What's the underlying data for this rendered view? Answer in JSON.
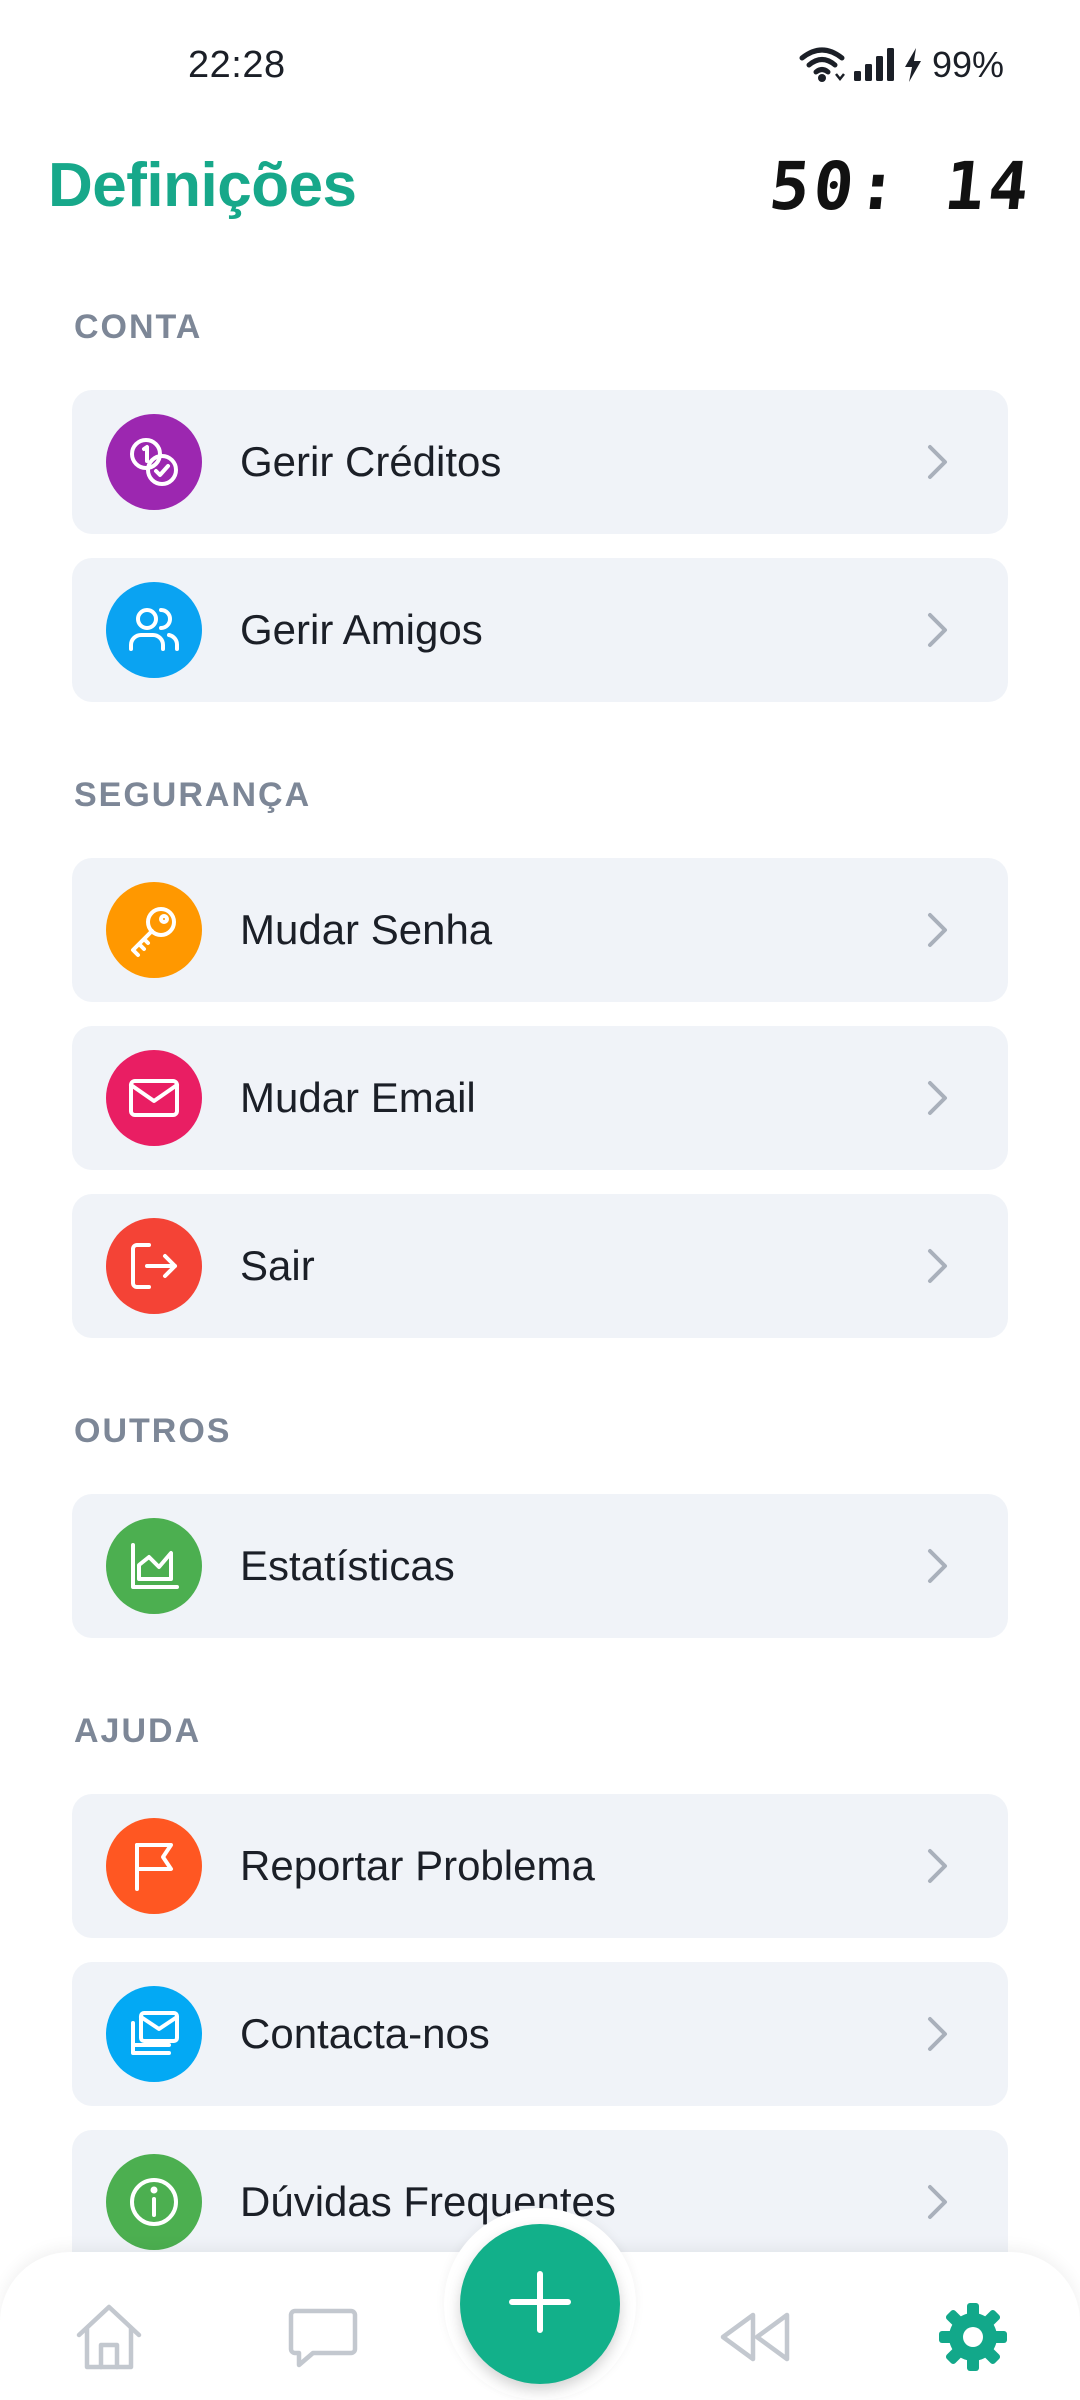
{
  "status_bar": {
    "time": "22:28",
    "battery": "99%"
  },
  "header": {
    "title": "Definições",
    "timer": "50: 14"
  },
  "colors": {
    "accent": "#17a88a",
    "credits": "#9c27b0",
    "friends": "#0aa3f2",
    "password": "#ff9800",
    "email": "#e91e63",
    "logout": "#f44336",
    "stats": "#4caf50",
    "report": "#ff5722",
    "contact": "#03a9f4",
    "faq": "#4caf50"
  },
  "sections": {
    "account": {
      "title": "CONTA",
      "items": [
        {
          "label": "Gerir Créditos",
          "icon": "coins-icon"
        },
        {
          "label": "Gerir Amigos",
          "icon": "users-icon"
        }
      ]
    },
    "security": {
      "title": "SEGURANÇA",
      "items": [
        {
          "label": "Mudar Senha",
          "icon": "key-icon"
        },
        {
          "label": "Mudar Email",
          "icon": "mail-icon"
        },
        {
          "label": "Sair",
          "icon": "logout-icon"
        }
      ]
    },
    "others": {
      "title": "OUTROS",
      "items": [
        {
          "label": "Estatísticas",
          "icon": "chart-icon"
        }
      ]
    },
    "help": {
      "title": "AJUDA",
      "items": [
        {
          "label": "Reportar Problema",
          "icon": "flag-icon"
        },
        {
          "label": "Contacta-nos",
          "icon": "mailbox-icon"
        },
        {
          "label": "Dúvidas Frequentes",
          "icon": "info-icon"
        }
      ]
    }
  },
  "bottom_nav": {
    "items": [
      "home-icon",
      "chat-icon",
      "add-icon",
      "rewind-icon",
      "settings-icon"
    ],
    "active": "settings-icon"
  }
}
